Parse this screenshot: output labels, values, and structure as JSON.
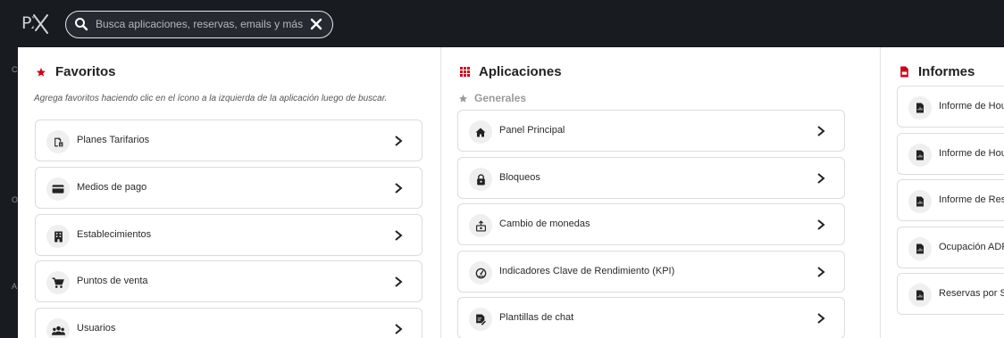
{
  "app": {
    "logo_text": "PX"
  },
  "search": {
    "placeholder": "Busca aplicaciones, reservas, emails y más"
  },
  "left_strip": [
    "C",
    "O",
    "A"
  ],
  "favorites": {
    "title": "Favoritos",
    "hint": "Agrega favoritos haciendo clic en el ícono a la izquierda de la aplicación luego de buscar.",
    "items": [
      {
        "label": "Planes Tarifarios",
        "icon": "rate-plans-icon"
      },
      {
        "label": "Medios de pago",
        "icon": "credit-card-icon"
      },
      {
        "label": "Establecimientos",
        "icon": "building-icon"
      },
      {
        "label": "Puntos de venta",
        "icon": "cart-icon"
      },
      {
        "label": "Usuarios",
        "icon": "users-icon"
      }
    ]
  },
  "applications": {
    "title": "Aplicaciones",
    "section": "Generales",
    "items": [
      {
        "label": "Panel Principal",
        "icon": "home-icon"
      },
      {
        "label": "Bloqueos",
        "icon": "lock-icon"
      },
      {
        "label": "Cambio de monedas",
        "icon": "currency-exchange-icon"
      },
      {
        "label": "Indicadores Clave de Rendimiento (KPI)",
        "icon": "speedometer-icon"
      },
      {
        "label": "Plantillas de chat",
        "icon": "chat-template-icon"
      }
    ]
  },
  "reports": {
    "title": "Informes",
    "items": [
      {
        "label": "Informe de Housek",
        "icon": "report-icon"
      },
      {
        "label": "Informe de Housek",
        "icon": "report-icon"
      },
      {
        "label": "Informe de Reserva",
        "icon": "report-icon"
      },
      {
        "label": "Ocupación ADR y R",
        "icon": "report-icon"
      },
      {
        "label": "Reservas por SKU (",
        "icon": "report-icon"
      }
    ]
  },
  "colors": {
    "accent": "#d0021b",
    "background": "#181b1f"
  }
}
